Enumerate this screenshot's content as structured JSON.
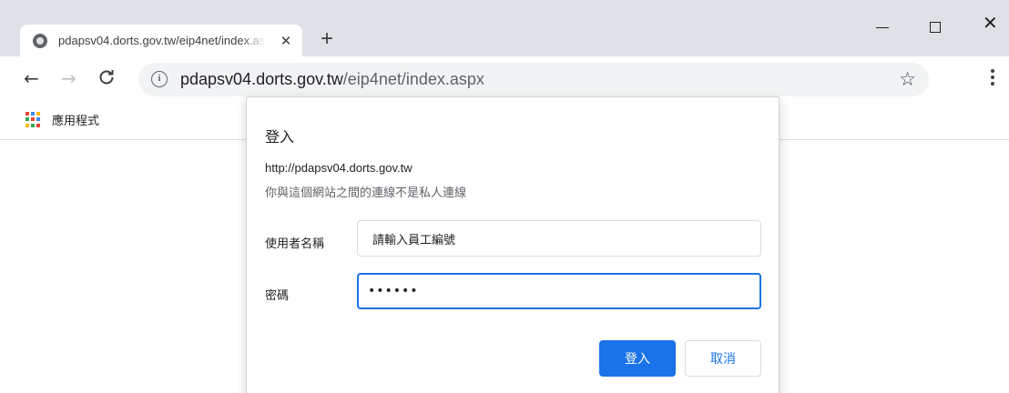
{
  "browser": {
    "tab": {
      "title": "pdapsv04.dorts.gov.tw/eip4net/index.aspx",
      "favicon": "globe-icon",
      "close": "✕"
    },
    "new_tab": "+",
    "window_controls": {
      "close": "✕"
    },
    "nav": {
      "back": "←",
      "forward": "→",
      "reload": "C"
    },
    "omnibox": {
      "info": "i",
      "url_host": "pdapsv04.dorts.gov.tw",
      "url_path": "/eip4net/index.aspx",
      "star": "☆"
    },
    "bookmarks": {
      "apps_label": "應用程式"
    }
  },
  "dialog": {
    "title": "登入",
    "origin": "http://pdapsv04.dorts.gov.tw",
    "warning": "你與這個網站之間的連線不是私人連線",
    "username_label": "使用者名稱",
    "username_value": "請輸入員工編號",
    "password_label": "密碼",
    "password_value": "••••••",
    "ok_button": "登入",
    "cancel_button": "取消"
  },
  "colors": {
    "accent": "#1a73e8",
    "apps_grid": [
      "#ea4335",
      "#4285f4",
      "#fbbc05",
      "#34a853",
      "#ea4335",
      "#4285f4",
      "#fbbc05",
      "#34a853",
      "#ea4335"
    ]
  }
}
